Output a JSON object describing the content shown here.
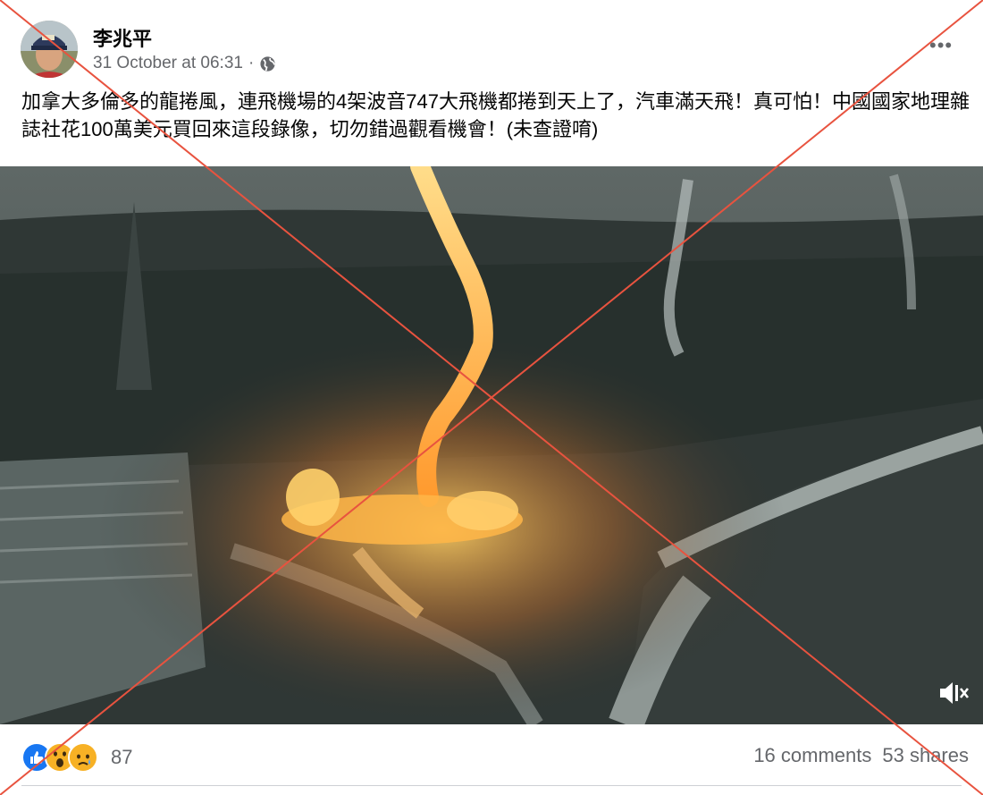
{
  "post": {
    "author": "李兆平",
    "timestamp": "31 October at 06:31",
    "separator": "·",
    "privacy_icon": "globe-icon",
    "more_icon": "more-options-icon",
    "more_label": "•••",
    "text": "加拿大多倫多的龍捲風，連飛機場的4架波音747大飛機都捲到天上了，汽車滿天飛！真可怕！中國國家地理雜誌社花100萬美元買回來這段錄像，切勿錯過觀看機會！(未查證唷)",
    "media": {
      "type": "video",
      "mute_icon": "muted-speaker-icon"
    },
    "reactions": {
      "icons": [
        "like-icon",
        "wow-icon",
        "sad-icon"
      ],
      "count": "87"
    },
    "comments": "16 comments",
    "shares": "53 shares"
  },
  "overlay": {
    "cross_color": "#e8533f"
  }
}
